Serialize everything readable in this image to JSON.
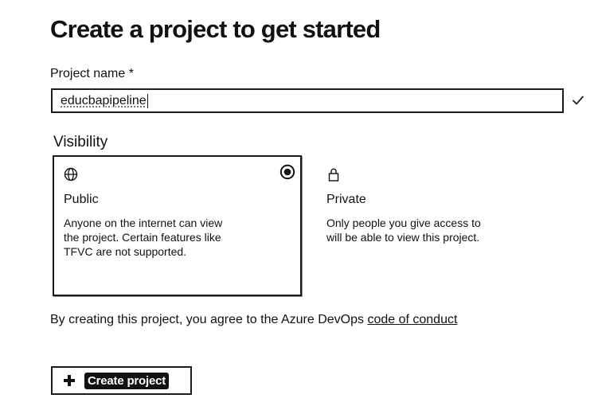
{
  "page": {
    "title": "Create a project to get started"
  },
  "project_name": {
    "label": "Project name *",
    "value": "educbapipeline",
    "valid_icon": "checkmark-icon"
  },
  "visibility": {
    "label": "Visibility",
    "options": [
      {
        "title": "Public",
        "description": "Anyone on the internet can view the project. Certain features like TFVC are not supported.",
        "icon": "globe-icon",
        "selected": true
      },
      {
        "title": "Private",
        "description": "Only people you give access to will be able to view this project.",
        "icon": "lock-icon",
        "selected": false
      }
    ]
  },
  "agreement": {
    "text": "By creating this project, you agree to the Azure DevOps ",
    "link": "code of conduct"
  },
  "create_button": {
    "label": "Create project",
    "icon": "plus-icon"
  },
  "colors": {
    "text": "#111111",
    "border": "#1b1b1b",
    "background": "#ffffff"
  }
}
